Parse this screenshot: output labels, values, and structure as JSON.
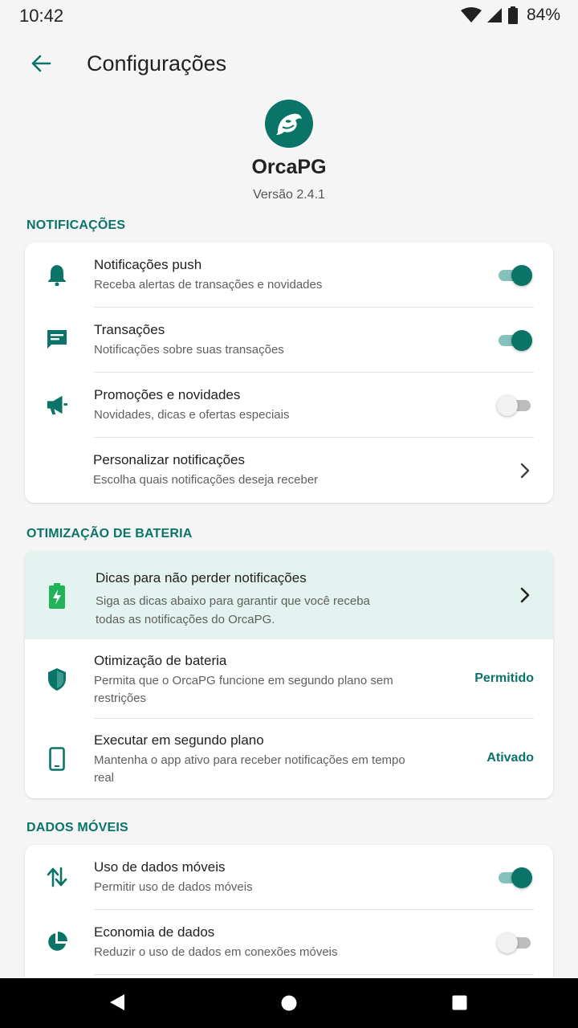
{
  "status": {
    "time": "10:42",
    "battery": "84%"
  },
  "appbar": {
    "title": "Configurações"
  },
  "brand": {
    "name": "OrcaPG",
    "version": "Versão 2.4.1"
  },
  "notifications": {
    "header": "NOTIFICAÇÕES",
    "items": [
      {
        "title": "Notificações push",
        "subtitle": "Receba alertas de transações e novidades",
        "enabled": true
      },
      {
        "title": "Transações",
        "subtitle": "Notificações sobre suas transações",
        "enabled": true
      },
      {
        "title": "Promoções e novidades",
        "subtitle": "Novidades, dicas e ofertas especiais",
        "enabled": false
      }
    ],
    "customize": {
      "title": "Personalizar notificações",
      "subtitle": "Escolha quais notificações deseja receber"
    }
  },
  "battery": {
    "header": "OTIMIZAÇÃO DE BATERIA",
    "tips": {
      "title": "Dicas para não perder notificações",
      "subtitle": "Siga as dicas abaixo para garantir que você receba todas as notificações do OrcaPG."
    },
    "optimization": {
      "title": "Otimização de bateria",
      "subtitle": "Permita que o OrcaPG funcione em segundo plano sem restrições",
      "value": "Permitido"
    },
    "background": {
      "title": "Executar em segundo plano",
      "subtitle": "Mantenha o app ativo para receber notificações em tempo real",
      "value": "Ativado"
    }
  },
  "mobile_data": {
    "header": "DADOS MÓVEIS",
    "items": [
      {
        "title": "Uso de dados móveis",
        "subtitle": "Permitir uso de dados móveis",
        "enabled": true
      },
      {
        "title": "Economia de dados",
        "subtitle": "Reduzir o uso de dados em conexões móveis",
        "enabled": false
      }
    ]
  },
  "colors": {
    "accent": "#0b7468",
    "tips_bg": "#e3f3f0",
    "background": "#f5f5f5"
  },
  "icons": [
    "wifi-icon",
    "signal-icon",
    "battery-icon",
    "back-arrow-icon",
    "orca-logo",
    "bell-icon",
    "message-icon",
    "megaphone-icon",
    "chevron-right-icon",
    "battery-charging-icon",
    "shield-icon",
    "phone-icon",
    "swap-vertical-icon",
    "pie-chart-icon",
    "nav-back-icon",
    "nav-home-icon",
    "nav-recents-icon"
  ]
}
